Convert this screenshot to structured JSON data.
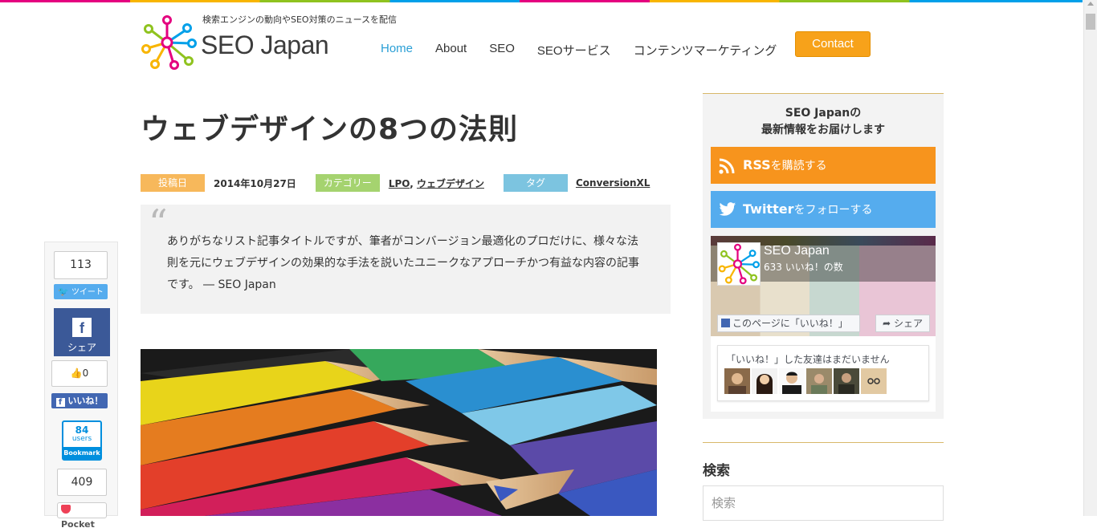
{
  "header": {
    "tagline": "検索エンジンの動向やSEO対策のニュースを配信",
    "brand": "SEO Japan"
  },
  "nav": {
    "items": [
      {
        "label": "Home",
        "active": true
      },
      {
        "label": "About"
      },
      {
        "label": "SEO"
      },
      {
        "label": "SEOサービス"
      },
      {
        "label": "コンテンツマーケティング"
      }
    ],
    "contact": "Contact"
  },
  "article": {
    "title": "ウェブデザインの8つの法則",
    "meta": {
      "date_label": "投稿日",
      "date": "2014年10月27日",
      "category_label": "カテゴリー",
      "category_1": "LPO",
      "category_sep": ", ",
      "category_2": "ウェブデザイン",
      "tag_label": "タグ",
      "tag": "ConversionXL"
    },
    "quote_mark": "“",
    "quote": "ありがちなリスト記事タイトルですが、筆者がコンバージョン最適化のプロだけに、様々な法則を元にウェブデザインの効果的な手法を説いたユニークなアプローチかつ有益な内容の記事です。 ― SEO Japan"
  },
  "share": {
    "tweet_count": "113",
    "tweet_label": "ツイート",
    "fb_share_label": "シェア",
    "fb_f": "f",
    "like_count": "0",
    "like_label": "いいね！",
    "hatena_count": "84",
    "hatena_users": "users",
    "hatena_label": "Bookmark",
    "pocket_count": "409",
    "pocket_label": "Pocket"
  },
  "sidebar": {
    "head_line1": "SEO Japanの",
    "head_line2": "最新情報をお届けします",
    "rss_bold": "RSS",
    "rss_rest": "を購読する",
    "twitter_bold": "Twitter",
    "twitter_rest": "をフォローする",
    "fb_page_name": "SEO Japan",
    "fb_likes": "633 いいね！の数",
    "fb_like_page": "このページに「いいね！」",
    "fb_share": "シェア",
    "fb_friends_text": "「いいね！」した友達はまだいません",
    "search_title": "検索",
    "search_placeholder": "検索"
  },
  "colors": {
    "accent_blue": "#2a9fd6",
    "contact_orange": "#f7a21a",
    "rss_orange": "#f7941d",
    "twitter_blue": "#55acee",
    "facebook_blue": "#3b5998"
  }
}
